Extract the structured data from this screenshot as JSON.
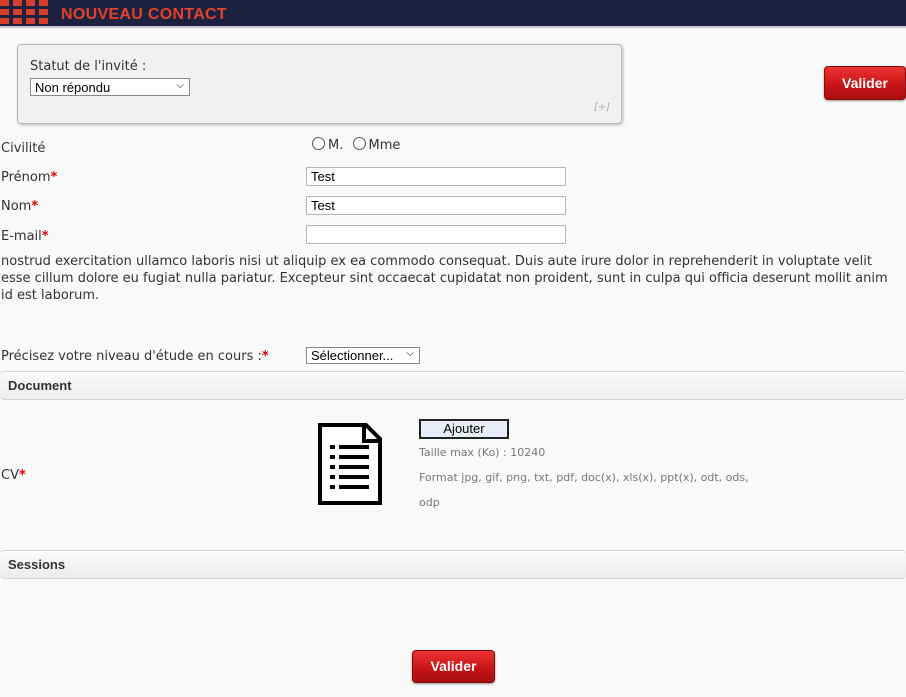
{
  "header": {
    "title": "NOUVEAU CONTACT"
  },
  "status": {
    "label": "Statut de l'invité :",
    "selected": "Non répondu",
    "expand": "[+]"
  },
  "buttons": {
    "valider_top": "Valider",
    "valider_bottom": "Valider",
    "ajouter": "Ajouter"
  },
  "form": {
    "civilite": {
      "label": "Civilité",
      "options": [
        "M.",
        "Mme"
      ]
    },
    "prenom": {
      "label": "Prénom",
      "value": "Test"
    },
    "nom": {
      "label": "Nom",
      "value": "Test"
    },
    "email": {
      "label": "E-mail",
      "value": ""
    },
    "required_mark": "*",
    "paragraph": "nostrud exercitation ullamco laboris nisi ut aliquip ex ea commodo consequat. Duis aute irure dolor in reprehenderit in voluptate velit esse cillum dolore eu fugiat nulla pariatur. Excepteur sint occaecat cupidatat non proident, sunt in culpa qui officia deserunt mollit anim id est laborum.",
    "niveau": {
      "label": "Précisez votre niveau d'étude en cours :",
      "selected": "Sélectionner..."
    }
  },
  "sections": {
    "document": "Document",
    "sessions": "Sessions"
  },
  "cv": {
    "label": "CV",
    "max_size": "Taille max (Ko) : 10240",
    "formats_line1": "Format jpg, gif, png, txt, pdf, doc(x), xls(x), ppt(x), odt, ods,",
    "formats_line2": "odp"
  },
  "colors": {
    "header_bg": "#1c2240",
    "header_title": "#e2422c",
    "button_red": "#c41416",
    "required": "#dd0000"
  },
  "icons": {
    "document": "document-icon",
    "chevron": "chevron-down-icon",
    "logo": "logo-squares-icon"
  }
}
